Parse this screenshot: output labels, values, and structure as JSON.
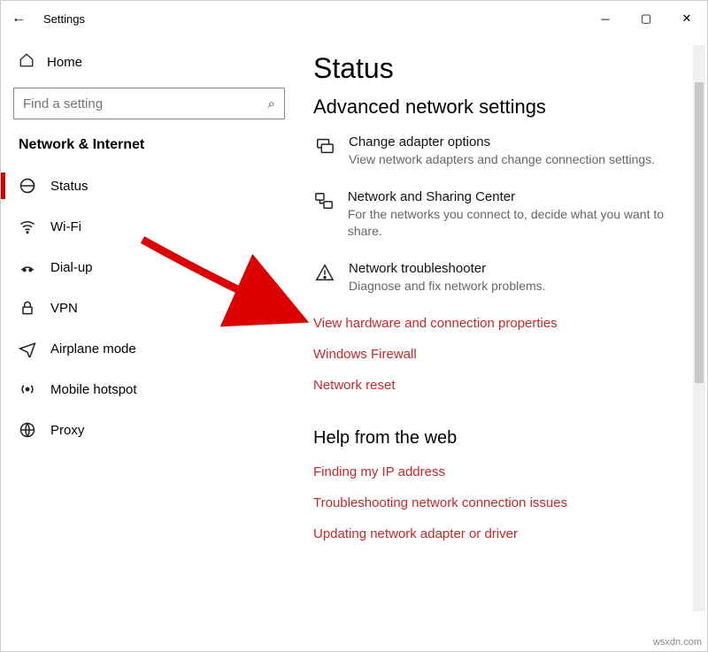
{
  "titlebar": {
    "back": "←",
    "title": "Settings"
  },
  "sidebar": {
    "home": "Home",
    "search_placeholder": "Find a setting",
    "section": "Network & Internet",
    "items": [
      {
        "label": "Status"
      },
      {
        "label": "Wi-Fi"
      },
      {
        "label": "Dial-up"
      },
      {
        "label": "VPN"
      },
      {
        "label": "Airplane mode"
      },
      {
        "label": "Mobile hotspot"
      },
      {
        "label": "Proxy"
      }
    ]
  },
  "main": {
    "heading": "Status",
    "subheading": "Advanced network settings",
    "options": [
      {
        "title": "Change adapter options",
        "desc": "View network adapters and change connection settings."
      },
      {
        "title": "Network and Sharing Center",
        "desc": "For the networks you connect to, decide what you want to share."
      },
      {
        "title": "Network troubleshooter",
        "desc": "Diagnose and fix network problems."
      }
    ],
    "links": [
      "View hardware and connection properties",
      "Windows Firewall",
      "Network reset"
    ],
    "help_heading": "Help from the web",
    "help_links": [
      "Finding my IP address",
      "Troubleshooting network connection issues",
      "Updating network adapter or driver"
    ]
  },
  "watermark": "wsxdn.com"
}
